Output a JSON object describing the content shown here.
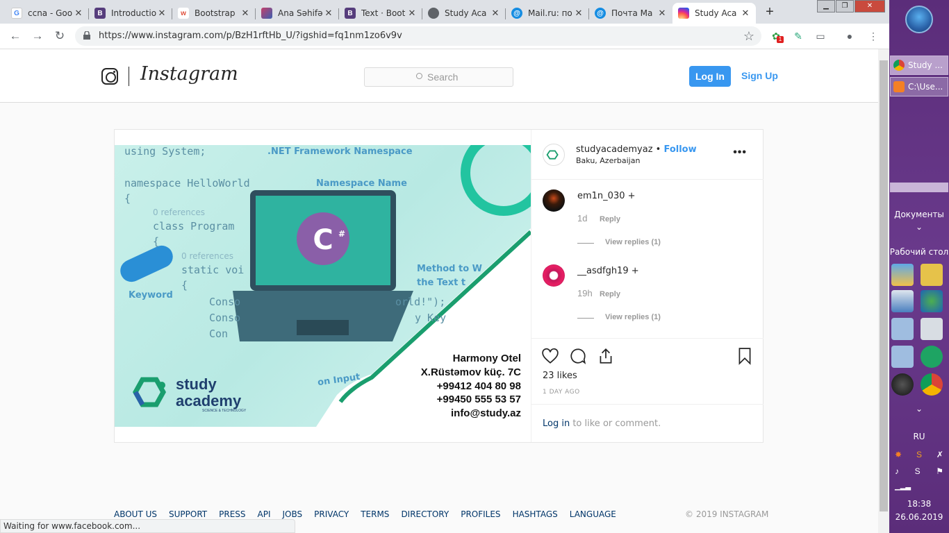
{
  "browser": {
    "tabs": [
      {
        "title": "ccna - Goo",
        "favicon": "google-icon",
        "color": "#4285f4"
      },
      {
        "title": "Introductio",
        "favicon": "bootstrap-icon",
        "color": "#563d7c"
      },
      {
        "title": "Bootstrap",
        "favicon": "w3-icon",
        "color": "#e04f3b"
      },
      {
        "title": "Ana Səhifə",
        "favicon": "site-icon",
        "color": "#c43f6a"
      },
      {
        "title": "Text · Boot",
        "favicon": "bootstrap-icon",
        "color": "#563d7c"
      },
      {
        "title": "Study Aca",
        "favicon": "globe-icon",
        "color": "#5f6368"
      },
      {
        "title": "Mail.ru: по",
        "favicon": "mailru-icon",
        "color": "#168de2"
      },
      {
        "title": "Почта Ма",
        "favicon": "mailru-icon",
        "color": "#168de2"
      },
      {
        "title": "Study Aca",
        "favicon": "instagram-icon",
        "color": "#d6249f"
      }
    ],
    "url": "https://www.instagram.com/p/BzH1rftHb_U/?igshid=fq1nm1zo6v9v",
    "extension_badge": "1",
    "status_text": "Waiting for www.facebook.com..."
  },
  "instagram": {
    "wordmark": "Instagram",
    "search_placeholder": "Search",
    "login_label": "Log In",
    "signup_label": "Sign Up",
    "post": {
      "username": "studyacademyaz",
      "follow_label": "Follow",
      "location": "Baku, Azerbaijan",
      "image": {
        "code_lines": [
          "using System;",
          "namespace HelloWorld",
          "{",
          "class Program",
          "{",
          "static voi",
          "{",
          "Conso",
          "Conso",
          "Con"
        ],
        "annotations": [
          ".NET Framework Namespace",
          "Namespace Name",
          "Keyword",
          "Method to W",
          "the Text t",
          "orld!\");",
          "y Key",
          "on Input"
        ],
        "references": [
          "0 references",
          "0 references"
        ],
        "logo_line1": "study",
        "logo_line2": "academy",
        "logo_tagline": "SCIENCE & TECHNOLOGY",
        "contact": [
          "Harmony Otel",
          "X.Rüstəmov küç. 7C",
          "+99412 404 80 98",
          "+99450 555 53 57",
          "info@study.az"
        ]
      },
      "comments": [
        {
          "user": "em1n_030 +",
          "time": "1d",
          "reply": "Reply",
          "view_replies": "View replies (1)"
        },
        {
          "user": "__asdfgh19 +",
          "time": "19h",
          "reply": "Reply",
          "view_replies": "View replies (1)"
        }
      ],
      "likes": "23 likes",
      "time_ago": "1 DAY AGO",
      "login_link": "Log in",
      "login_suffix": " to like or comment."
    },
    "footer": {
      "links": [
        "ABOUT US",
        "SUPPORT",
        "PRESS",
        "API",
        "JOBS",
        "PRIVACY",
        "TERMS",
        "DIRECTORY",
        "PROFILES",
        "HASHTAGS",
        "LANGUAGE"
      ],
      "copyright": "© 2019 INSTAGRAM"
    }
  },
  "windows": {
    "tasks": [
      "Study ...",
      "C:\\Use..."
    ],
    "documents_label": "Документы",
    "desktop_label": "Рабочий стол",
    "lang": "RU",
    "time": "18:38",
    "date": "26.06.2019"
  },
  "colors": {
    "accent": "#3897f0",
    "link_dark": "#003569",
    "taskbar": "#5b2d7a"
  }
}
